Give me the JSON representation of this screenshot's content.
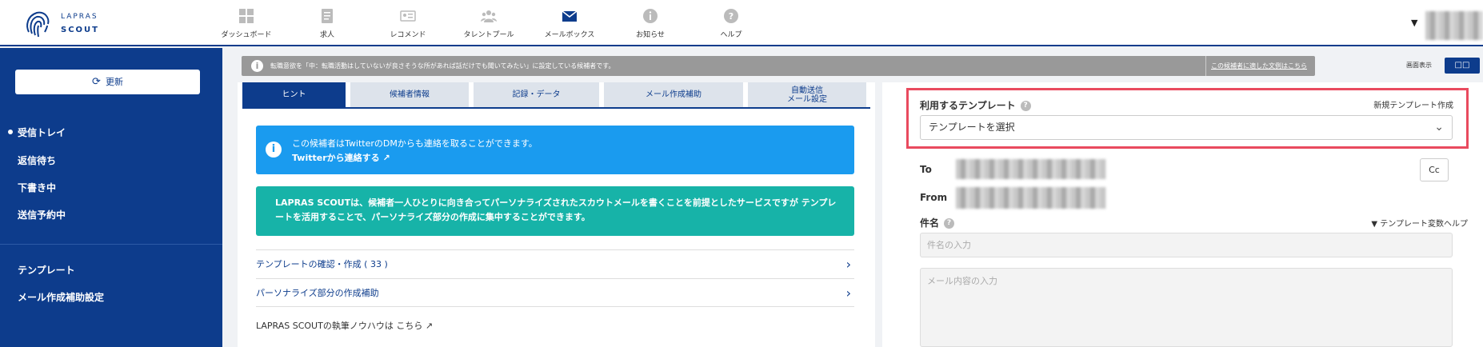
{
  "header": {
    "logo_line1": "LAPRAS",
    "logo_line2": "SCOUT",
    "nav": [
      {
        "label": "ダッシュボード",
        "icon": "dashboard-icon"
      },
      {
        "label": "求人",
        "icon": "document-icon"
      },
      {
        "label": "レコメンド",
        "icon": "id-card-icon"
      },
      {
        "label": "タレントプール",
        "icon": "people-icon"
      },
      {
        "label": "メールボックス",
        "icon": "mail-icon"
      },
      {
        "label": "お知らせ",
        "icon": "info-icon"
      },
      {
        "label": "ヘルプ",
        "icon": "help-icon"
      }
    ],
    "active_nav": "メールボックス"
  },
  "sidebar": {
    "refresh_label": "更新",
    "items": [
      "受信トレイ",
      "返信待ち",
      "下書き中",
      "送信予約中"
    ],
    "items2": [
      "テンプレート",
      "メール作成補助設定"
    ]
  },
  "banner": {
    "message": "転職意欲を「中：転職活動はしていないが良さそうな所があれば話だけでも聞いてみたい」に設定している候補者です。",
    "link": "この候補者に適した文例はこちら"
  },
  "display": {
    "label": "画面表示",
    "button": "□□"
  },
  "tabs": [
    {
      "label": "ヒント",
      "active": true
    },
    {
      "label": "候補者情報"
    },
    {
      "label": "記録・データ"
    },
    {
      "label": "メール作成補助"
    },
    {
      "label": "自動送信\nメール設定"
    }
  ],
  "hint": {
    "blue_line1": "この候補者はTwitterのDMからも連絡を取ることができます。",
    "blue_line2": "Twitterから連絡する ↗",
    "teal_text": "LAPRAS SCOUTは、候補者一人ひとりに向き合ってパーソナライズされたスカウトメールを書くことを前提としたサービスですが テンプレートを活用することで、パーソナライズ部分の作成に集中することができます。",
    "links": [
      "テンプレートの確認・作成 ( 33 )",
      "パーソナライズ部分の作成補助"
    ],
    "howto": "LAPRAS SCOUTの執筆ノウハウは こちら ↗"
  },
  "composer": {
    "template_label": "利用するテンプレート",
    "template_new": "新規テンプレート作成",
    "template_select": "テンプレートを選択",
    "to_label": "To",
    "from_label": "From",
    "cc_label": "Cc",
    "subject_label": "件名",
    "var_help": "▼ テンプレート変数ヘルプ",
    "subject_placeholder": "件名の入力",
    "body_placeholder": "メール内容の入力"
  }
}
